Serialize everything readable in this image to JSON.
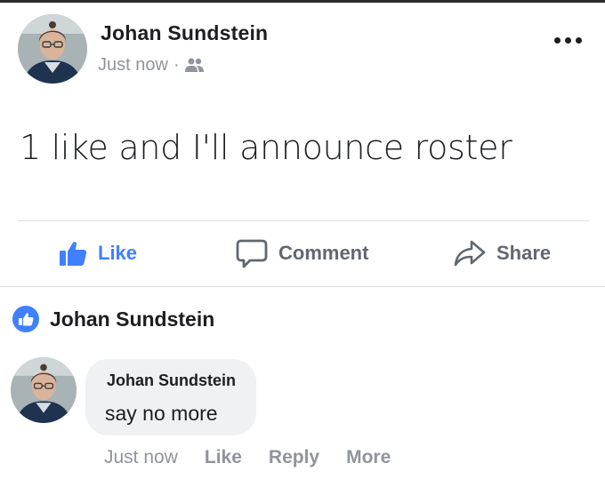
{
  "post": {
    "author": "Johan Sundstein",
    "timestamp": "Just now",
    "separator": "·",
    "audience_icon": "friends-icon",
    "text": "1 like and I'll announce roster",
    "menu_icon": "more-dots-icon"
  },
  "actions": {
    "like_label": "Like",
    "comment_label": "Comment",
    "share_label": "Share"
  },
  "reactions": {
    "icon": "like-badge-icon",
    "name": "Johan Sundstein"
  },
  "comment": {
    "author": "Johan Sundstein",
    "text": "say no more",
    "timestamp": "Just now",
    "like_label": "Like",
    "reply_label": "Reply",
    "more_label": "More"
  },
  "colors": {
    "accent": "#4080ff",
    "muted": "#90949c",
    "action_gray": "#606770",
    "bubble": "#f0f1f3",
    "text": "#1c1e21"
  }
}
